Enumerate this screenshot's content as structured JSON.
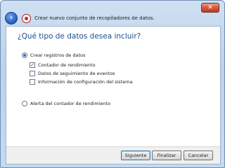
{
  "window": {
    "title": "Crear nuevo conjunto de recopiladores de datos.",
    "close_label": "✕"
  },
  "wizard": {
    "heading": "¿Qué tipo de datos desea incluir?",
    "options": {
      "create_logs": {
        "label": "Crear registros de datos",
        "selected": true
      },
      "perf_counter": {
        "label": "Contador de rendimiento",
        "checked": true
      },
      "event_trace": {
        "label": "Datos de seguimiento de eventos",
        "checked": false
      },
      "sys_config": {
        "label": "Información de configuración del sistema",
        "checked": false
      },
      "perf_alert": {
        "label": "Alerta del contador de rendimiento",
        "selected": false
      }
    }
  },
  "footer": {
    "next_label": "Siguiente",
    "finish_label": "Finalizar",
    "cancel_label": "Cancelar"
  },
  "colors": {
    "heading": "#1a4e8c",
    "accent": "#2f6bd1"
  },
  "icons": {
    "back": "back-arrow-icon",
    "app": "data-collector-icon",
    "close": "close-icon"
  }
}
